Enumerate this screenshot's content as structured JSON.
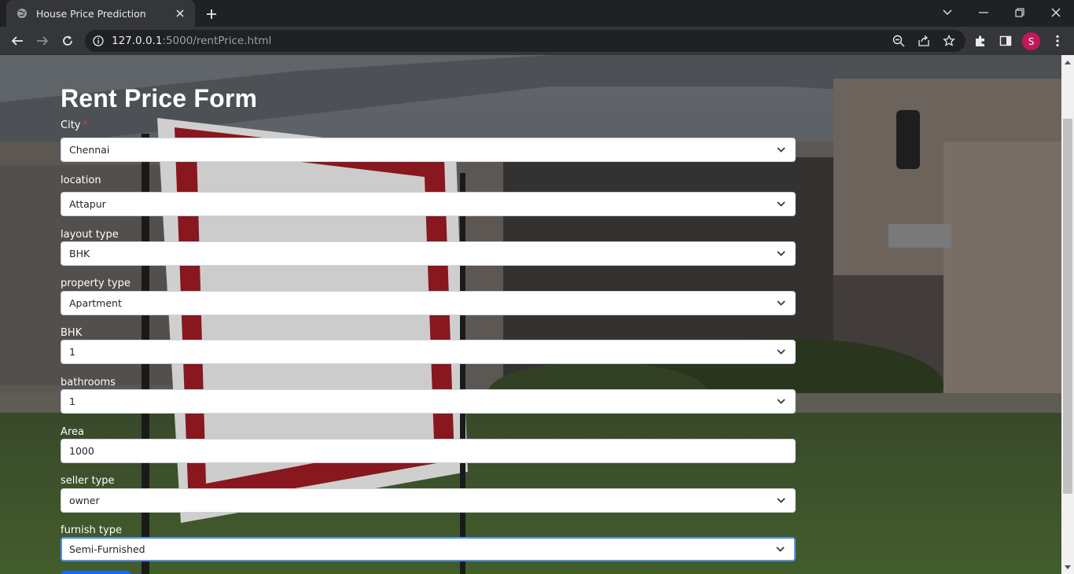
{
  "browser": {
    "tab_title": "House Price Prediction",
    "url_host": "127.0.0.1",
    "url_path": ":5000/rentPrice.html",
    "profile_initial": "S",
    "accent_profile": "#c2185b"
  },
  "form": {
    "title": "Rent Price Form",
    "fields": [
      {
        "label": "City",
        "required": "*",
        "value": "Chennai",
        "type": "select"
      },
      {
        "label": "location",
        "value": "Attapur",
        "type": "select"
      },
      {
        "label": "layout type",
        "value": "BHK",
        "type": "select"
      },
      {
        "label": "property type",
        "value": "Apartment",
        "type": "select"
      },
      {
        "label": "BHK",
        "value": "1",
        "type": "select"
      },
      {
        "label": "bathrooms",
        "value": "1",
        "type": "select"
      },
      {
        "label": "Area",
        "value": "1000",
        "type": "input"
      },
      {
        "label": "seller type",
        "value": "owner",
        "type": "select"
      },
      {
        "label": "furnish type",
        "value": "Semi-Furnished",
        "type": "select"
      }
    ]
  },
  "icons": {
    "favicon": "globe-icon",
    "select_arrow": "chevron-down-icon"
  }
}
